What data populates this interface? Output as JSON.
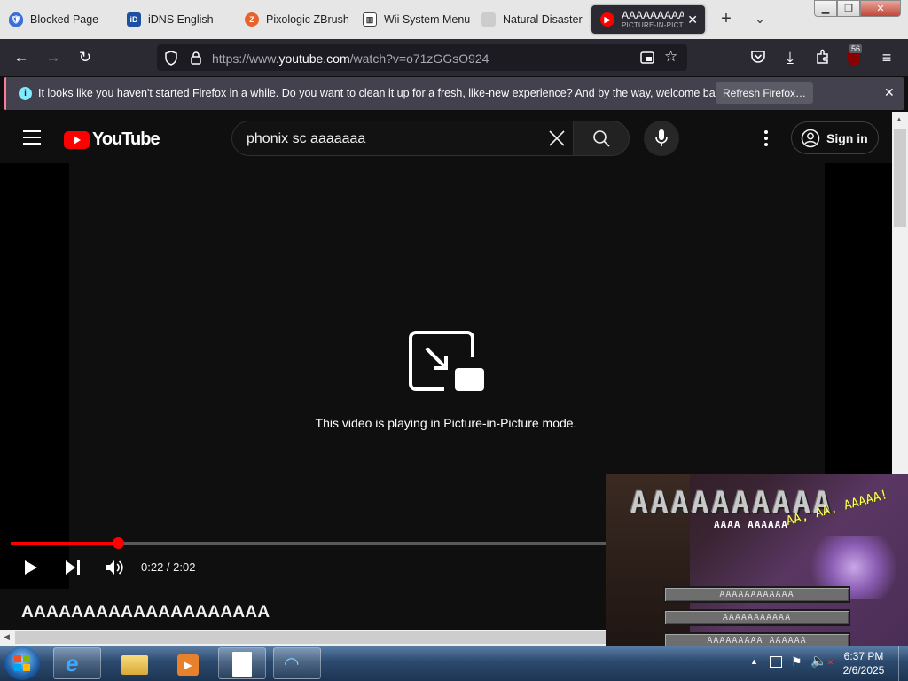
{
  "browser": {
    "tabs": [
      {
        "title": "Blocked Page",
        "favicon": "shield-icon"
      },
      {
        "title": "iDNS English",
        "favicon": "idns-icon"
      },
      {
        "title": "Pixologic ZBrush",
        "favicon": "zbrush-icon"
      },
      {
        "title": "Wii System Menu",
        "favicon": "wii-icon"
      },
      {
        "title": "Natural Disaster",
        "favicon": "page-icon"
      },
      {
        "title": "AAAAAAAAA",
        "subtitle": "PICTURE-IN-PICTURE",
        "favicon": "youtube-icon",
        "active": true
      }
    ],
    "url_prefix": "https://www.",
    "url_domain": "youtube.com",
    "url_path": "/watch?v=o71zGGsO924",
    "extensions_badge": "56"
  },
  "notification": {
    "message": "It looks like you haven't started Firefox in a while. Do you want to clean it up for a fresh, like-new experience? And by the way, welcome back!",
    "button": "Refresh Firefox…"
  },
  "youtube": {
    "logo_text": "YouTube",
    "search_value": "phonix sc aaaaaaa",
    "signin_label": "Sign in",
    "pip_message": "This video is playing in Picture-in-Picture mode.",
    "time_current": "0:22",
    "time_total": "2:02",
    "time_display": "0:22 / 2:02",
    "progress_fraction": 0.18,
    "video_title": "AAAAAAAAAAAAAAAAAAAA"
  },
  "pip_window": {
    "logo_text": "AAAAAAAAAA",
    "logo_subtitle": "AAAA AAAAAA",
    "splash_text": "AA, AA, AAAAA!",
    "buttons": [
      "AAAAAAAAAAAA",
      "AAAAAAAAAAA",
      "AAAAAAAAA AAAAAA"
    ]
  },
  "taskbar": {
    "time": "6:37 PM",
    "date": "2/6/2025"
  },
  "colors": {
    "youtube_red": "#ff0000",
    "firefox_toolbar": "#2b2a33",
    "notification_accent": "#ff7b9c",
    "yt_background": "#0f0f0f"
  }
}
